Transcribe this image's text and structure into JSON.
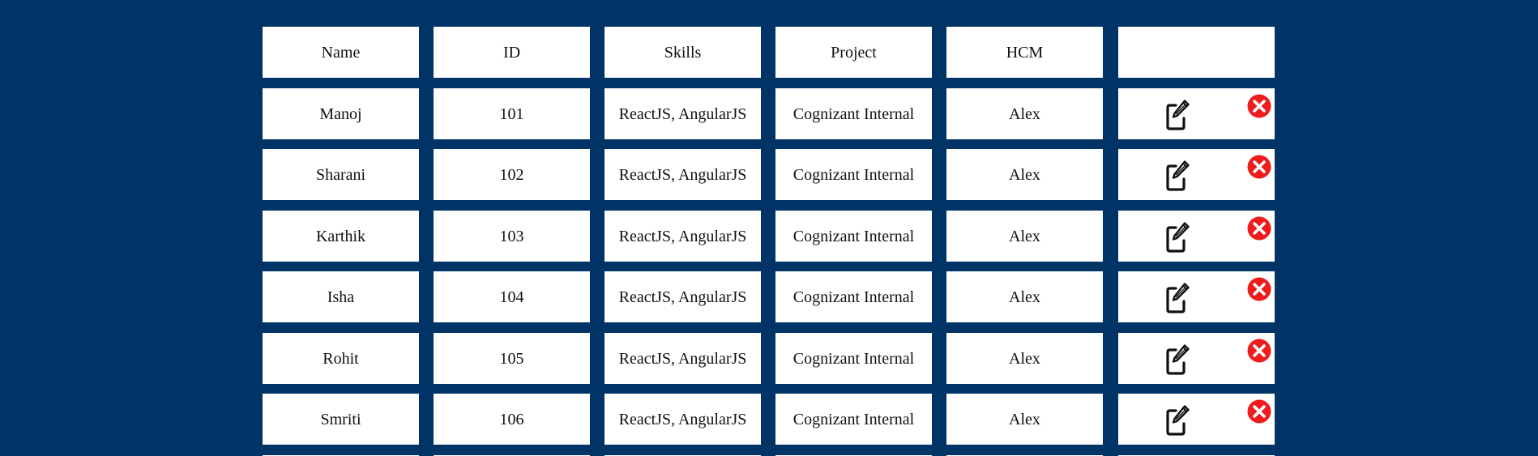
{
  "colors": {
    "page_background": "#003366",
    "cell_background": "#ffffff",
    "text": "#111111",
    "delete_icon": "#ee1c1c",
    "edit_icon": "#111111"
  },
  "table": {
    "headers": [
      "Name",
      "ID",
      "Skills",
      "Project",
      "HCM",
      ""
    ],
    "rows": [
      {
        "name": "Manoj",
        "id": "101",
        "skills": "ReactJS, AngularJS",
        "project": "Cognizant Internal",
        "hcm": "Alex"
      },
      {
        "name": "Sharani",
        "id": "102",
        "skills": "ReactJS, AngularJS",
        "project": "Cognizant Internal",
        "hcm": "Alex"
      },
      {
        "name": "Karthik",
        "id": "103",
        "skills": "ReactJS, AngularJS",
        "project": "Cognizant Internal",
        "hcm": "Alex"
      },
      {
        "name": "Isha",
        "id": "104",
        "skills": "ReactJS, AngularJS",
        "project": "Cognizant Internal",
        "hcm": "Alex"
      },
      {
        "name": "Rohit",
        "id": "105",
        "skills": "ReactJS, AngularJS",
        "project": "Cognizant Internal",
        "hcm": "Alex"
      },
      {
        "name": "Smriti",
        "id": "106",
        "skills": "ReactJS, AngularJS",
        "project": "Cognizant Internal",
        "hcm": "Alex"
      }
    ],
    "row_actions": {
      "edit_icon": "edit-icon",
      "delete_icon": "delete-icon"
    }
  }
}
